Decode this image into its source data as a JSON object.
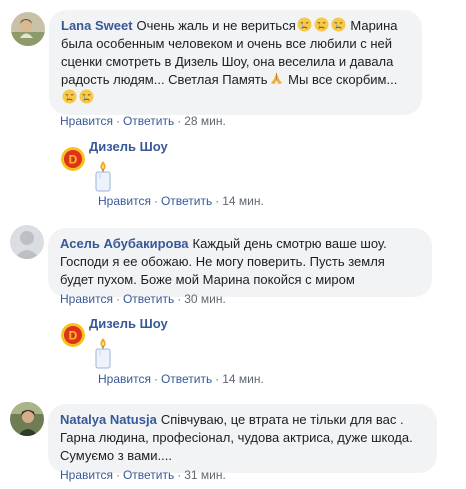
{
  "comments": [
    {
      "author": "Lana Sweet",
      "text_parts": [
        "Очень жаль и не вериться",
        "Марина была особенным человеком и очень все любили с ней сценки смотреть в Дизель Шоу, она веселила и давала радость людям... Светлая Память",
        "Мы все скорбим..."
      ],
      "actions": {
        "like": "Нравится",
        "reply": "Ответить",
        "time": "28 мин."
      }
    },
    {
      "author": "Асель Абубакирова",
      "text": "Каждый день смотрю ваше шоу. Господи я ее обожаю. Не могу поверить. Пусть земля будет пухом. Боже мой Марина покойся с миром",
      "actions": {
        "like": "Нравится",
        "reply": "Ответить",
        "time": "30 мин."
      }
    },
    {
      "author": "Natalya Natusja",
      "text": "Співчуваю, це втрата не тільки для вас . Гарна людина, професіонал, чудова актриса, дуже шкода. Сумуємо з вами....",
      "actions": {
        "like": "Нравится",
        "reply": "Ответить",
        "time": "31 мин."
      }
    }
  ],
  "replies": [
    {
      "author": "Дизель Шоу",
      "actions": {
        "like": "Нравится",
        "reply": "Ответить",
        "time": "14 мин."
      }
    },
    {
      "author": "Дизель Шоу",
      "actions": {
        "like": "Нравится",
        "reply": "Ответить",
        "time": "14 мин."
      }
    }
  ],
  "separator": "·",
  "icons": {
    "sad_emoji": "crying-face-icon",
    "pray_emoji": "folded-hands-icon",
    "candle": "candle-icon",
    "page_logo": "diesel-show-logo"
  },
  "colors": {
    "link": "#385898",
    "bubble": "#f2f3f5",
    "meta": "#606770"
  }
}
